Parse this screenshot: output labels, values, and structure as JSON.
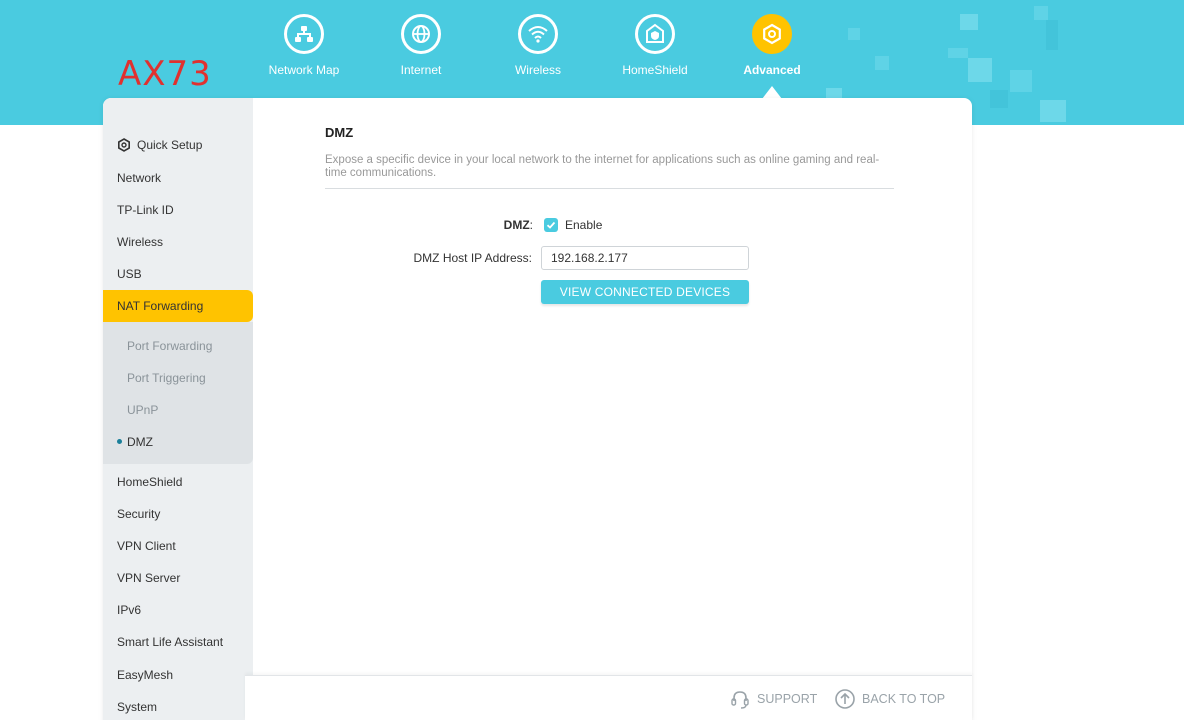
{
  "brand": {
    "model": "AX73",
    "color": "#e0312f"
  },
  "colors": {
    "accent": "#4acbe0",
    "active": "#ffc300"
  },
  "topnav": [
    {
      "label": "Network Map",
      "icon": "network-map-icon"
    },
    {
      "label": "Internet",
      "icon": "globe-icon"
    },
    {
      "label": "Wireless",
      "icon": "wifi-icon"
    },
    {
      "label": "HomeShield",
      "icon": "homeshield-icon"
    },
    {
      "label": "Advanced",
      "icon": "gear-icon",
      "active": true
    }
  ],
  "sidebar": {
    "quick_setup": "Quick Setup",
    "items_top": [
      "Network",
      "TP-Link ID",
      "Wireless",
      "USB"
    ],
    "active": "NAT Forwarding",
    "sub_items": [
      "Port Forwarding",
      "Port Triggering",
      "UPnP",
      "DMZ"
    ],
    "items_bottom": [
      "HomeShield",
      "Security",
      "VPN Client",
      "VPN Server",
      "IPv6",
      "Smart Life Assistant",
      "EasyMesh",
      "System"
    ]
  },
  "content": {
    "title": "DMZ",
    "description": "Expose a specific device in your local network to the internet for applications such as online gaming and real-time communications.",
    "dmz_label": "DMZ",
    "dmz_colon": ":",
    "enable_label": "Enable",
    "enable_checked": true,
    "host_ip_label": "DMZ Host IP Address:",
    "host_ip_value": "192.168.2.177",
    "view_button": "VIEW CONNECTED DEVICES"
  },
  "footer": {
    "support": "SUPPORT",
    "back_to_top": "BACK TO TOP"
  }
}
